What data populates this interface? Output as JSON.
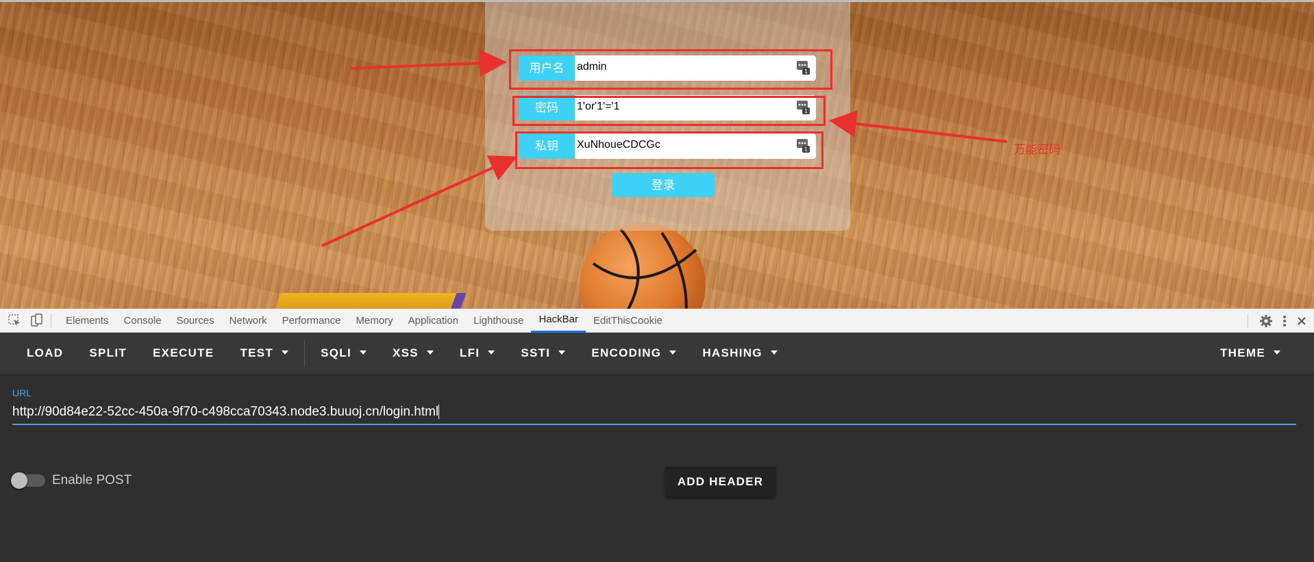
{
  "login_form": {
    "username_label": "用户名",
    "username_value": "admin",
    "password_label": "密码",
    "password_value": "1'or'1'='1",
    "key_label": "私钥",
    "key_value": "XuNhoueCDCGc",
    "submit_label": "登录"
  },
  "annotation": {
    "note_text": "万能密码",
    "color": "#e8302f"
  },
  "devtools": {
    "tabs": [
      "Elements",
      "Console",
      "Sources",
      "Network",
      "Performance",
      "Memory",
      "Application",
      "Lighthouse",
      "HackBar",
      "EditThisCookie"
    ],
    "active_tab": "HackBar"
  },
  "hackbar": {
    "menu": {
      "load": "LOAD",
      "split": "SPLIT",
      "execute": "EXECUTE",
      "test": "TEST",
      "sqli": "SQLI",
      "xss": "XSS",
      "lfi": "LFI",
      "ssti": "SSTI",
      "encoding": "ENCODING",
      "hashing": "HASHING",
      "theme": "THEME"
    },
    "url_label": "URL",
    "url_value": "http://90d84e22-52cc-450a-9f70-c498cca70343.node3.buuoj.cn/login.html",
    "enable_post_label": "Enable POST",
    "enable_post": false,
    "add_header_label": "ADD HEADER"
  },
  "colors": {
    "field_label_bg": "#3ed1f7",
    "hackbar_accent": "#4b9ff0",
    "toolbar_bg": "#383838",
    "body_bg": "#2f2f2f"
  }
}
